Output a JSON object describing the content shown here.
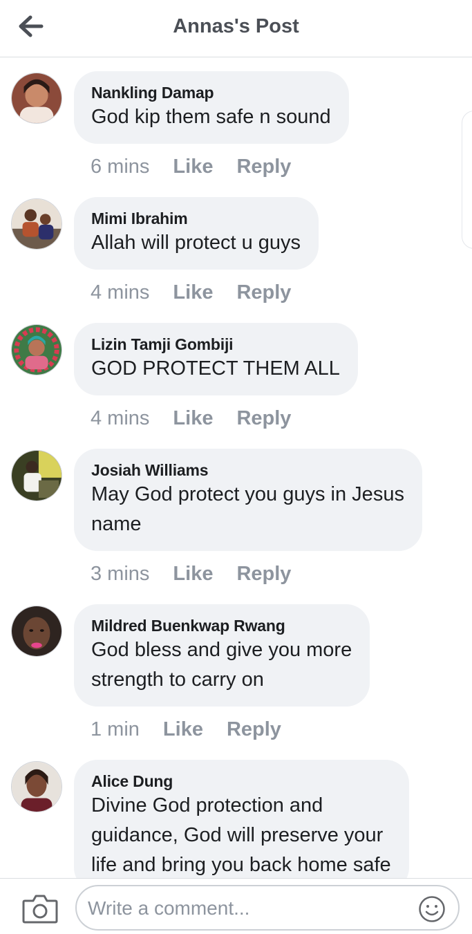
{
  "header": {
    "title": "Annas's Post",
    "back_icon": "arrow-left-icon"
  },
  "comments": [
    {
      "author": "Nankling Damap",
      "lines": [
        "God kip them safe n sound"
      ],
      "time": "6 mins",
      "like": "Like",
      "reply": "Reply"
    },
    {
      "author": "Mimi Ibrahim",
      "lines": [
        "Allah will protect u guys"
      ],
      "time": "4 mins",
      "like": "Like",
      "reply": "Reply"
    },
    {
      "author": "Lizin Tamji Gombiji",
      "lines": [
        "GOD PROTECT THEM ALL"
      ],
      "time": "4 mins",
      "like": "Like",
      "reply": "Reply"
    },
    {
      "author": "Josiah Williams",
      "lines": [
        "May God protect you guys in Jesus",
        "name"
      ],
      "time": "3 mins",
      "like": "Like",
      "reply": "Reply"
    },
    {
      "author": "Mildred Buenkwap Rwang",
      "lines": [
        "God bless and give you more",
        "strength to carry on"
      ],
      "time": "1 min",
      "like": "Like",
      "reply": "Reply"
    },
    {
      "author": "Alice Dung",
      "lines": [
        "Divine God protection and",
        "guidance, God will preserve your",
        "life and bring you back home safe"
      ]
    }
  ],
  "composer": {
    "placeholder": "Write a comment...",
    "camera_icon": "camera-icon",
    "emoji_icon": "smiley-icon"
  },
  "colors": {
    "bubble": "#f0f2f5",
    "meta": "#8d949e",
    "title": "#4b4f56"
  }
}
